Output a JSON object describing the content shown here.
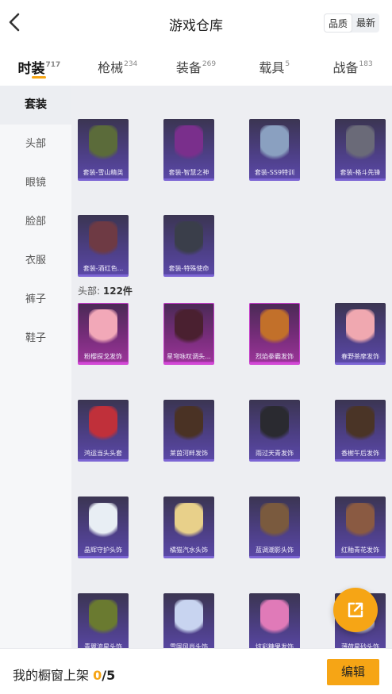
{
  "header": {
    "title": "游戏仓库",
    "sort_options": [
      "品质",
      "最新"
    ],
    "sort_active": "品质"
  },
  "tabs": [
    {
      "label": "时装",
      "count": "717",
      "active": true
    },
    {
      "label": "枪械",
      "count": "234",
      "active": false
    },
    {
      "label": "装备",
      "count": "269",
      "active": false
    },
    {
      "label": "载具",
      "count": "5",
      "active": false
    },
    {
      "label": "战备",
      "count": "183",
      "active": false
    }
  ],
  "sidebar": {
    "items": [
      {
        "label": "套装",
        "active": true
      },
      {
        "label": "头部",
        "active": false
      },
      {
        "label": "眼镜",
        "active": false
      },
      {
        "label": "脸部",
        "active": false
      },
      {
        "label": "衣服",
        "active": false
      },
      {
        "label": "裤子",
        "active": false
      },
      {
        "label": "鞋子",
        "active": false
      }
    ]
  },
  "sets": {
    "items": [
      {
        "label": "套装-雪山精英",
        "rarity": "purple",
        "art": "#5b6b3a"
      },
      {
        "label": "套装-智慧之神",
        "rarity": "purple",
        "art": "#7a2f8c"
      },
      {
        "label": "套装-SS9特训",
        "rarity": "purple",
        "art": "#8aa0c0"
      },
      {
        "label": "套装-格斗先锋",
        "rarity": "purple",
        "art": "#6a6a78"
      },
      {
        "label": "套装-酒红色...",
        "rarity": "purple",
        "art": "#6e3a44"
      },
      {
        "label": "套装-特殊使命",
        "rarity": "purple",
        "art": "#3a3e4a"
      }
    ]
  },
  "head_section": {
    "title": "头部",
    "count_text": "122件",
    "items": [
      {
        "label": "粉樱探戈发饰",
        "rarity": "pink",
        "art": "#f2a8b8"
      },
      {
        "label": "星穹咏叹调头...",
        "rarity": "pink",
        "art": "#4a2030"
      },
      {
        "label": "烈焰拳霸发饰",
        "rarity": "pink",
        "art": "#c2702a"
      },
      {
        "label": "春野茶摩发饰",
        "rarity": "purple",
        "art": "#f0a8b0"
      },
      {
        "label": "鸿运当头头套",
        "rarity": "purple",
        "art": "#c0303a"
      },
      {
        "label": "莱茵河畔发饰",
        "rarity": "purple",
        "art": "#4a3224"
      },
      {
        "label": "雨过天青发饰",
        "rarity": "purple",
        "art": "#2a2a30"
      },
      {
        "label": "香榭午后发饰",
        "rarity": "purple",
        "art": "#4a3426"
      },
      {
        "label": "晶辉守护头饰",
        "rarity": "purple",
        "art": "#e8eef4"
      },
      {
        "label": "橘猫汽水头饰",
        "rarity": "purple",
        "art": "#e8d08a"
      },
      {
        "label": "蓝调潮影头饰",
        "rarity": "purple",
        "art": "#7a5a3e"
      },
      {
        "label": "红釉青花发饰",
        "rarity": "purple",
        "art": "#8a5a42"
      },
      {
        "label": "青翼流星头饰",
        "rarity": "purple",
        "art": "#6a7a30"
      },
      {
        "label": "雪国风尚头饰",
        "rarity": "purple",
        "art": "#c8d4f0"
      },
      {
        "label": "炫彩糖果发饰",
        "rarity": "purple",
        "art": "#e07ab8"
      },
      {
        "label": "薄荷星砂头饰",
        "rarity": "purple",
        "art": "#e0e4ea"
      }
    ]
  },
  "footer": {
    "label": "我的橱窗上架",
    "current": "0",
    "total": "/5",
    "edit_label": "编辑"
  },
  "icons": {
    "back": "chevron-left-icon",
    "share": "share-external-icon"
  },
  "colors": {
    "accent": "#f6a515",
    "purple_frame": "#7c65d4",
    "pink_frame": "#d24ad5"
  }
}
